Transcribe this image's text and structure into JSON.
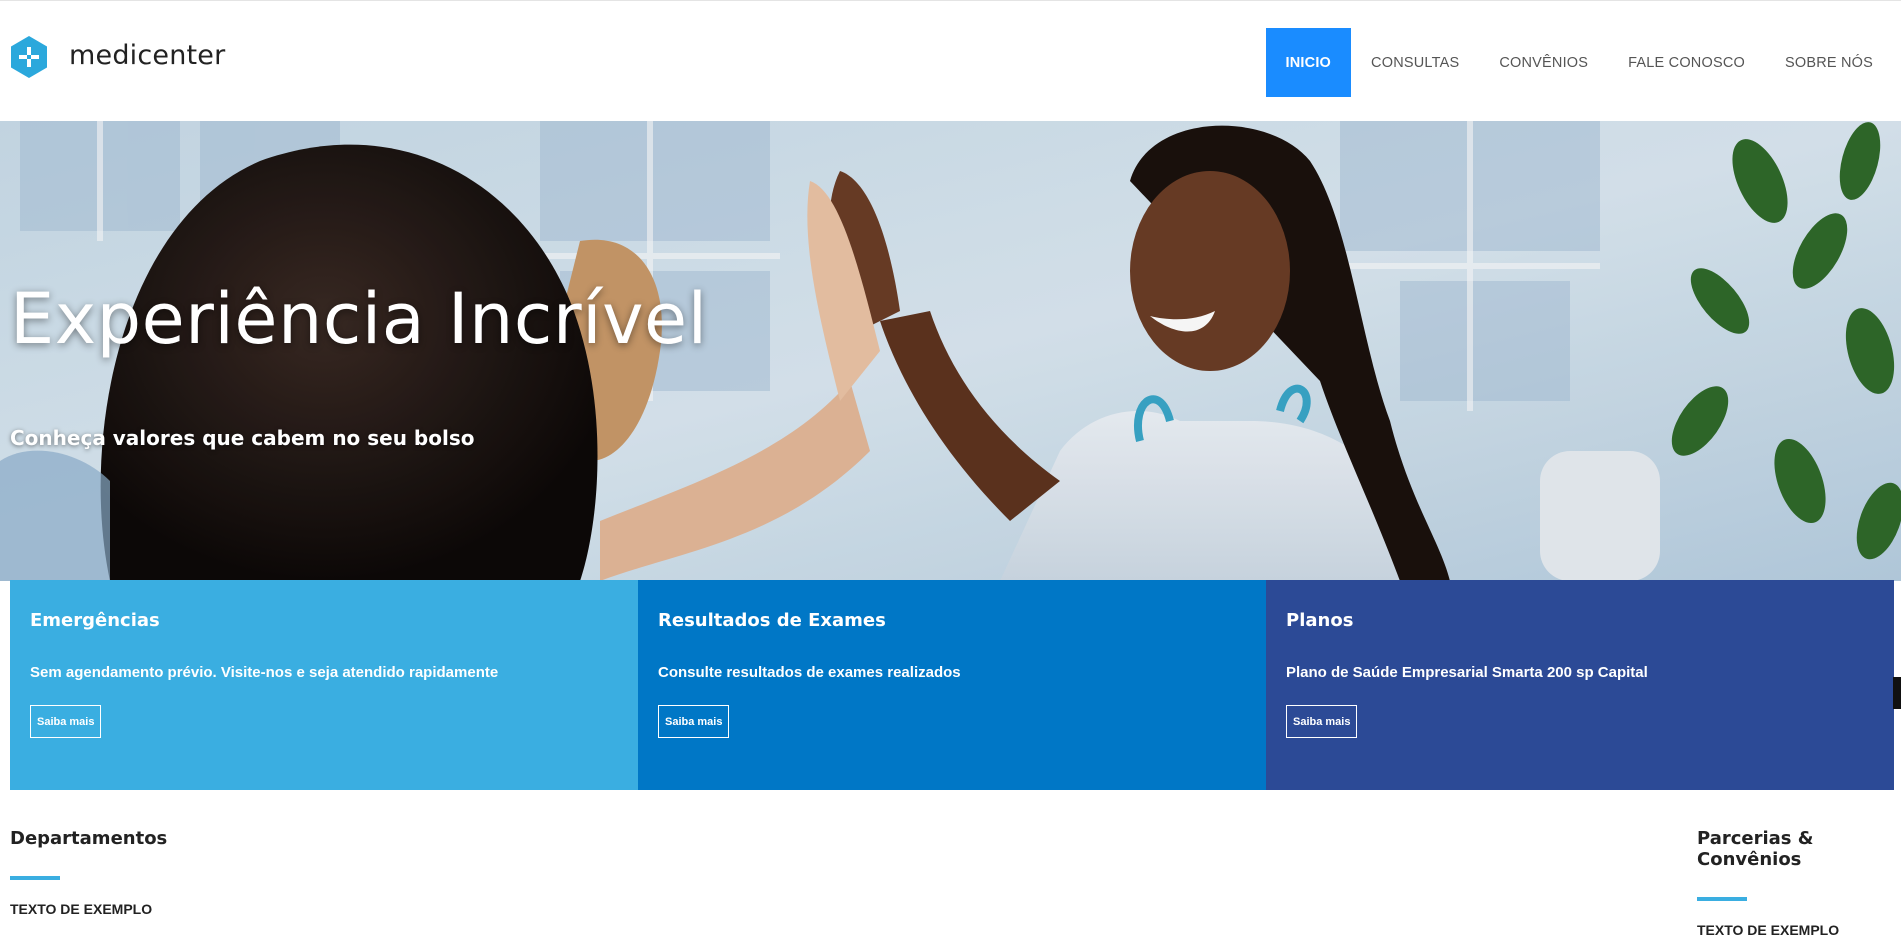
{
  "brand": {
    "name": "medicenter",
    "accent": "#1a8cff"
  },
  "nav": {
    "items": [
      {
        "label": "INICIO",
        "active": true
      },
      {
        "label": "CONSULTAS",
        "active": false
      },
      {
        "label": "CONVÊNIOS",
        "active": false
      },
      {
        "label": "FALE CONOSCO",
        "active": false
      },
      {
        "label": "SOBRE NÓS",
        "active": false
      }
    ]
  },
  "hero": {
    "title": "Experiência Incrível",
    "subtitle": "Conheça valores que cabem no seu bolso"
  },
  "features": [
    {
      "title": "Emergências",
      "text": "Sem agendamento prévio. Visite-nos e seja atendido rapidamente",
      "button": "Saiba mais",
      "color": "#3aaee1"
    },
    {
      "title": "Resultados de Exames",
      "text": "Consulte resultados de exames realizados",
      "button": "Saiba mais",
      "color": "#0077c6"
    },
    {
      "title": "Planos",
      "text": "Plano de Saúde Empresarial Smarta 200 sp Capital",
      "button": "Saiba mais",
      "color": "#2c4a96"
    }
  ],
  "sections": {
    "left": {
      "title": "Departamentos",
      "text": "TEXTO DE EXEMPLO"
    },
    "right": {
      "title": "Parcerias & Convênios",
      "text": "TEXTO DE EXEMPLO"
    }
  }
}
